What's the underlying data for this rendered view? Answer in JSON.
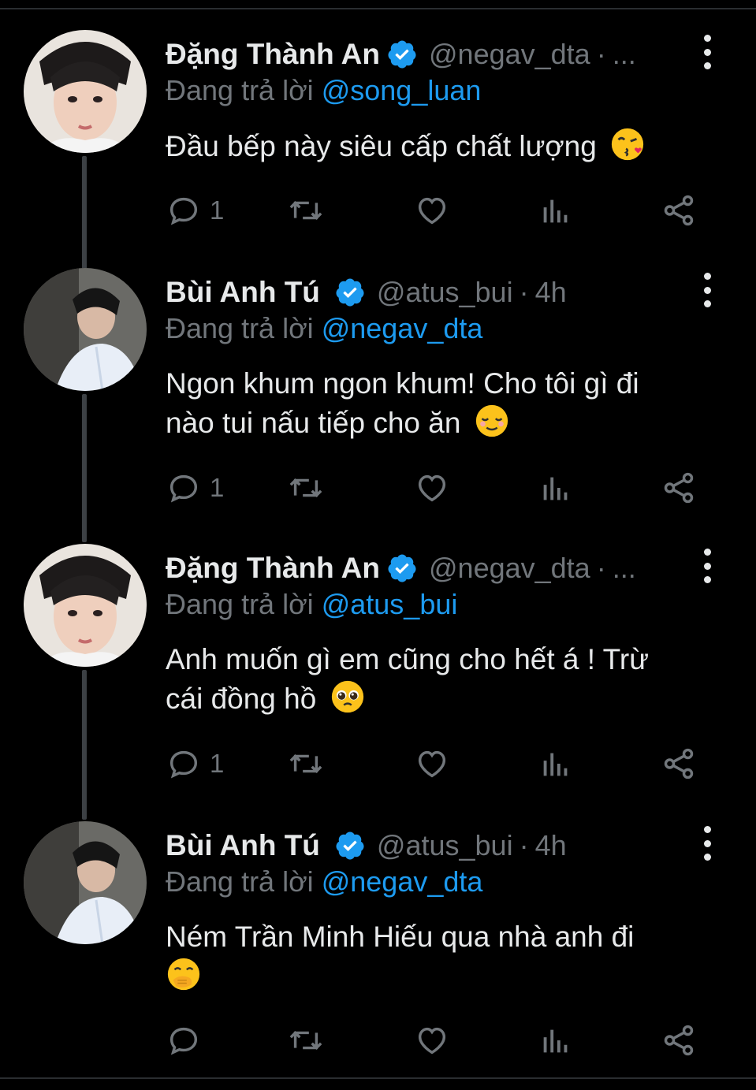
{
  "tweets": [
    {
      "name": "Đặng Thành An",
      "handle": "@negav_dta",
      "dot": "·",
      "time": "...",
      "reply_prefix": "Đang trả lời",
      "reply_to": "@song_luan",
      "lines": [
        "Đầu bếp này siêu cấp chất lượng"
      ],
      "emoji": "kissing-heart-face",
      "reply_count": "1"
    },
    {
      "name": "Bùi Anh Tú",
      "handle": "@atus_bui",
      "dot": "·",
      "time": "4h",
      "reply_prefix": "Đang trả lời",
      "reply_to": "@negav_dta",
      "lines": [
        "Ngon khum ngon khum! Cho tôi gì đi",
        "nào tui nấu tiếp cho ăn"
      ],
      "emoji": "relieved-face",
      "reply_count": "1"
    },
    {
      "name": "Đặng Thành An",
      "handle": "@negav_dta",
      "dot": "·",
      "time": "...",
      "reply_prefix": "Đang trả lời",
      "reply_to": "@atus_bui",
      "lines": [
        "Anh muốn gì em cũng cho hết á ! Trừ",
        "cái đồng hồ"
      ],
      "emoji": "pleading-face",
      "reply_count": "1"
    },
    {
      "name": "Bùi Anh Tú",
      "handle": "@atus_bui",
      "dot": "·",
      "time": "4h",
      "reply_prefix": "Đang trả lời",
      "reply_to": "@negav_dta",
      "lines": [
        "Ném Trần Minh Hiếu qua nhà anh đi",
        ""
      ],
      "emoji": "face-with-hand-over-mouth",
      "reply_count": ""
    }
  ],
  "colors": {
    "accent": "#1d9bf0",
    "muted": "#71767b",
    "text": "#e7e9ea",
    "background": "#000000"
  },
  "icons": [
    "reply-icon",
    "retweet-icon",
    "like-icon",
    "analytics-icon",
    "share-icon",
    "verified-badge-icon",
    "more-options-icon"
  ]
}
